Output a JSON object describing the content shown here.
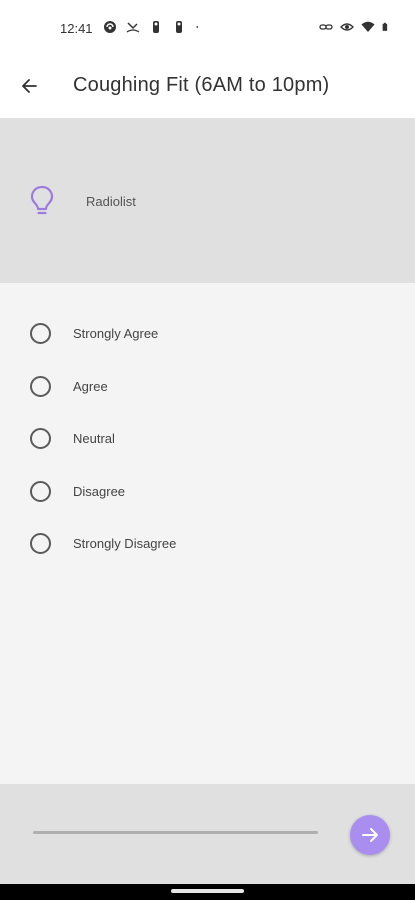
{
  "status_bar": {
    "time": "12:41",
    "left_icons": [
      "signal-app-icon",
      "call-missed-icon",
      "notification-icon",
      "notification-icon",
      "dot-icon"
    ],
    "right_icons": [
      "link-icon",
      "eye-icon",
      "wifi-icon",
      "battery-icon"
    ]
  },
  "app_bar": {
    "title": "Coughing Fit (6AM to 10pm)"
  },
  "question": {
    "type_label": "Radiolist",
    "accent_color": "#9b7be0"
  },
  "options": [
    {
      "label": "Strongly Agree",
      "selected": false
    },
    {
      "label": "Agree",
      "selected": false
    },
    {
      "label": "Neutral",
      "selected": false
    },
    {
      "label": "Disagree",
      "selected": false
    },
    {
      "label": "Strongly Disagree",
      "selected": false
    }
  ],
  "footer": {
    "progress": 0,
    "next_button_color": "#a98ef0"
  }
}
